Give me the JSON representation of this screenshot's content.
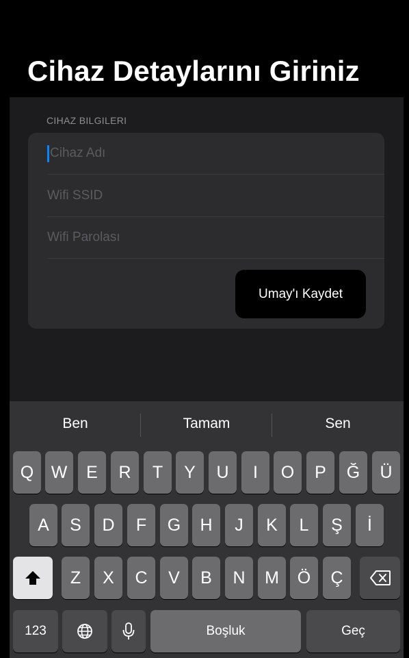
{
  "title": "Cihaz Detaylarını Giriniz",
  "section_header": "CIHAZ BILGILERI",
  "fields": [
    {
      "placeholder": "Cihaz Adı",
      "value": ""
    },
    {
      "placeholder": "Wifi SSID",
      "value": ""
    },
    {
      "placeholder": "Wifi Parolası",
      "value": ""
    }
  ],
  "save_button": "Umay'ı Kaydet",
  "keyboard": {
    "suggestions": [
      "Ben",
      "Tamam",
      "Sen"
    ],
    "row1": [
      "Q",
      "W",
      "E",
      "R",
      "T",
      "Y",
      "U",
      "I",
      "O",
      "P",
      "Ğ",
      "Ü"
    ],
    "row2": [
      "A",
      "S",
      "D",
      "F",
      "G",
      "H",
      "J",
      "K",
      "L",
      "Ş",
      "İ"
    ],
    "row3": [
      "Z",
      "X",
      "C",
      "V",
      "B",
      "N",
      "M",
      "Ö",
      "Ç"
    ],
    "numbers_key": "123",
    "space_key": "Boşluk",
    "return_key": "Geç",
    "icons": {
      "shift": "shift-icon",
      "delete": "delete-icon",
      "globe": "globe-icon",
      "mic": "microphone-icon"
    }
  },
  "colors": {
    "background": "#000000",
    "content_bg": "#1c1c1e",
    "card_bg": "#2c2c2e",
    "caret": "#0a84ff",
    "key": "#6c6c6f",
    "key_dark": "#4a4a4d"
  }
}
